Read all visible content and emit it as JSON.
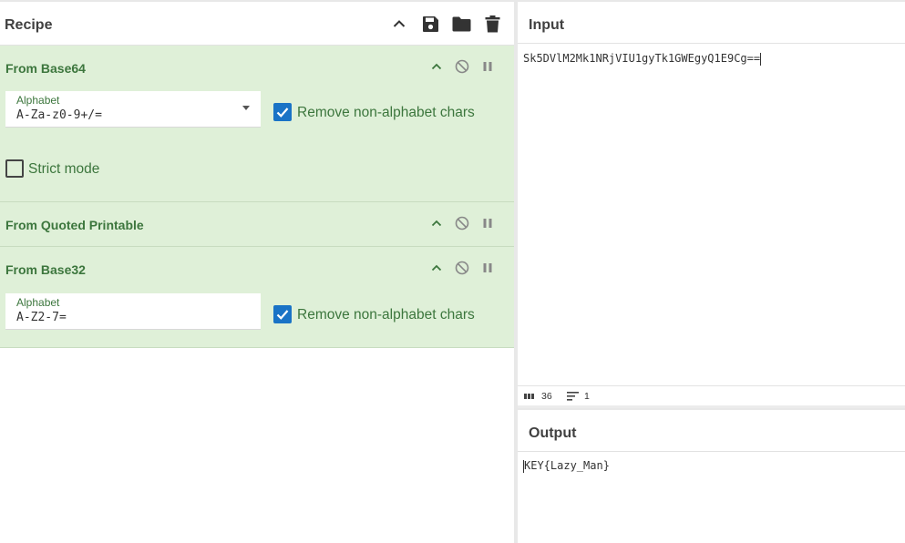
{
  "recipe": {
    "title": "Recipe",
    "toolbar_icons": [
      "chevron-up-icon",
      "save-icon",
      "folder-icon",
      "trash-icon"
    ],
    "operations": [
      {
        "name": "From Base64",
        "alphabet_label": "Alphabet",
        "alphabet_value": "A-Za-z0-9+/=",
        "remove_non_alphabet_label": "Remove non-alphabet chars",
        "remove_non_alphabet_checked": true,
        "strict_mode_label": "Strict mode",
        "strict_mode_checked": false
      },
      {
        "name": "From Quoted Printable"
      },
      {
        "name": "From Base32",
        "alphabet_label": "Alphabet",
        "alphabet_value": "A-Z2-7=",
        "remove_non_alphabet_label": "Remove non-alphabet chars",
        "remove_non_alphabet_checked": true
      }
    ]
  },
  "input": {
    "title": "Input",
    "text": "Sk5DVlM2Mk1NRjVIU1gyTk1GWEgyQ1E9Cg==",
    "char_count": "36",
    "line_count": "1"
  },
  "output": {
    "title": "Output",
    "text": "KEY{Lazy_Man}"
  },
  "colors": {
    "op_background": "#dff0d8",
    "op_text": "#3c763d",
    "checkbox_accent": "#1a73c6"
  }
}
